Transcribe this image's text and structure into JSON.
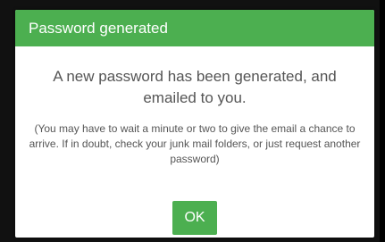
{
  "dialog": {
    "title": "Password generated",
    "message": "A new password has been generated, and emailed to you.",
    "note": "(You may have to wait a minute or two to give the email a chance to arrive. If in doubt, check your junk mail folders, or just request another password)",
    "ok_label": "OK"
  },
  "colors": {
    "accent": "#4caf50",
    "text": "#555555",
    "background": "#ffffff"
  }
}
